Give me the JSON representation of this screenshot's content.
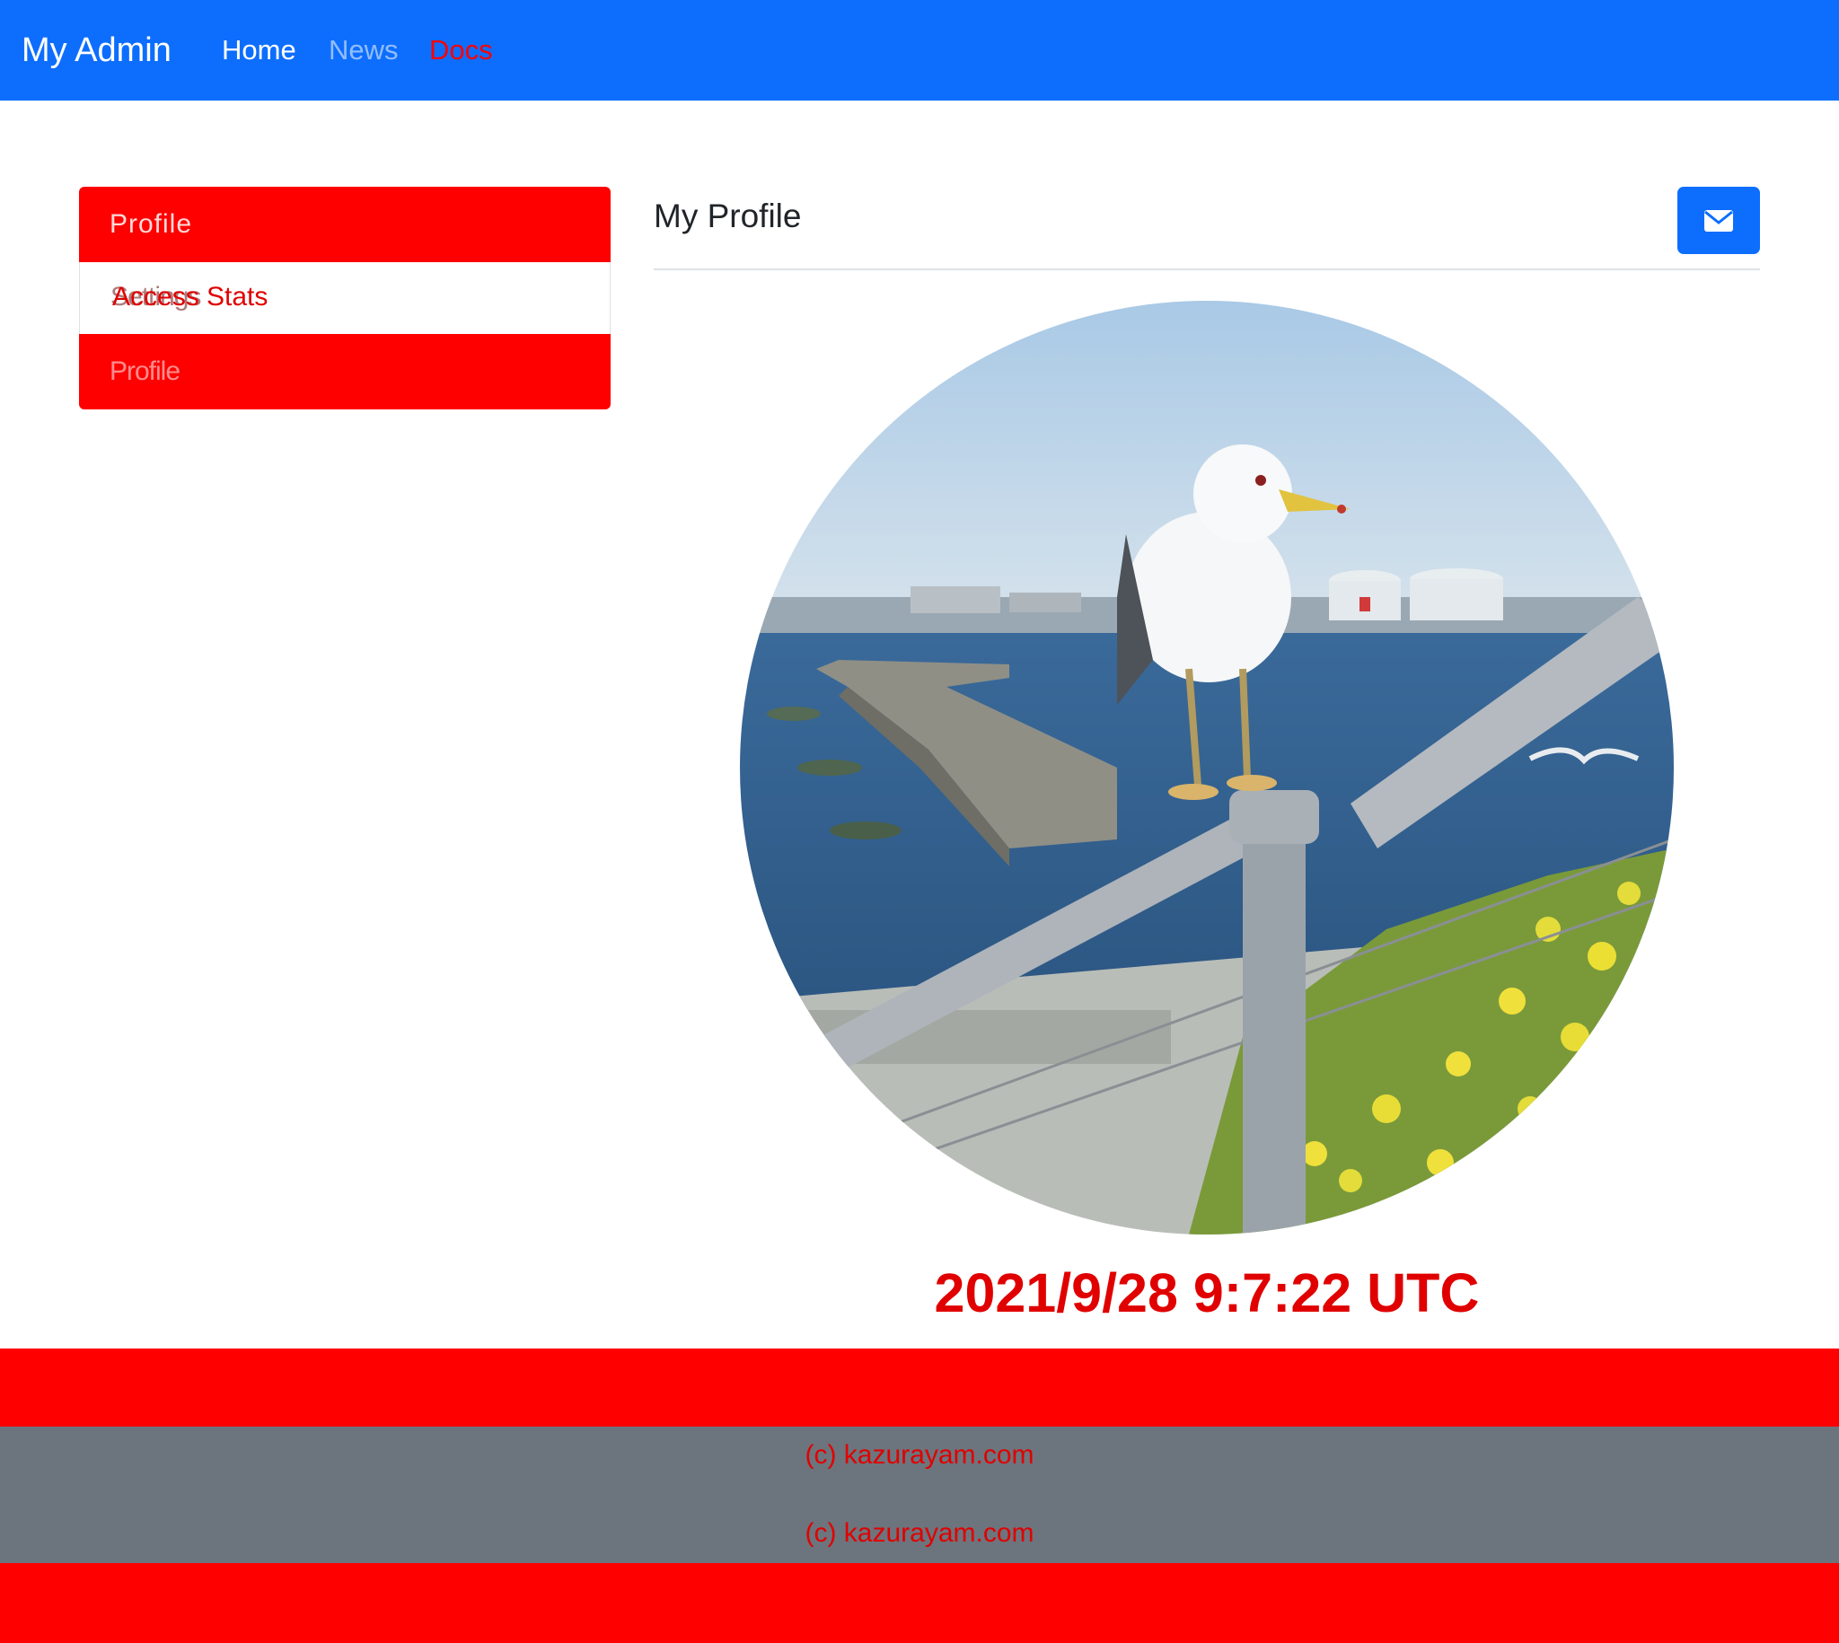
{
  "navbar": {
    "brand": "My Admin",
    "links": [
      {
        "label": "Home"
      },
      {
        "label": "News"
      },
      {
        "label": "Docs"
      }
    ]
  },
  "sidebar": {
    "items": [
      {
        "label": "Profile"
      },
      {
        "label": "Settings"
      },
      {
        "label": "Access Stats"
      },
      {
        "label": "Profile"
      }
    ]
  },
  "main": {
    "title": "My Profile",
    "mail_icon": "envelope-icon",
    "timestamp": "2021/9/28 9:7:22 UTC"
  },
  "footer": {
    "copyright_lines": [
      "(c) kazurayam.com",
      "(c) kazurayam.com"
    ]
  },
  "colors": {
    "primary": "#0d6efd",
    "accent_red": "#ff0000",
    "footer_gray": "#6c757d"
  }
}
